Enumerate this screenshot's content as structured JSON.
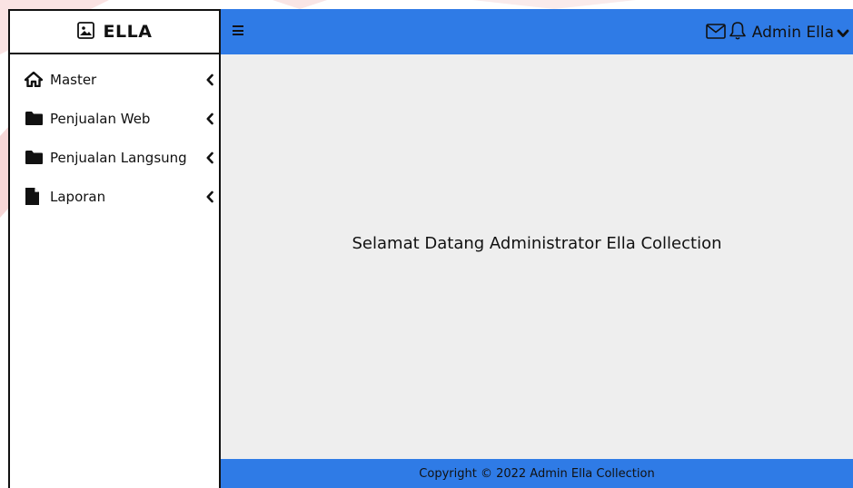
{
  "brand": {
    "title": "ELLA",
    "icon": "image-icon"
  },
  "sidebar": {
    "items": [
      {
        "label": "Master",
        "icon": "home-icon"
      },
      {
        "label": "Penjualan Web",
        "icon": "folder-icon"
      },
      {
        "label": "Penjualan Langsung",
        "icon": "folder-icon"
      },
      {
        "label": "Laporan",
        "icon": "file-icon"
      }
    ]
  },
  "topbar": {
    "menu_icon": "hamburger-icon",
    "mail_icon": "mail-icon",
    "bell_icon": "bell-icon",
    "user_name": "Admin Ella",
    "dropdown_icon": "chevron-down-icon"
  },
  "main": {
    "welcome_text": "Selamat Datang Administrator Ella Collection"
  },
  "footer": {
    "text": "Copyright © 2022 Admin Ella Collection"
  },
  "colors": {
    "accent": "#2f7be6",
    "content_bg": "#eeeeee",
    "border": "#111111"
  }
}
